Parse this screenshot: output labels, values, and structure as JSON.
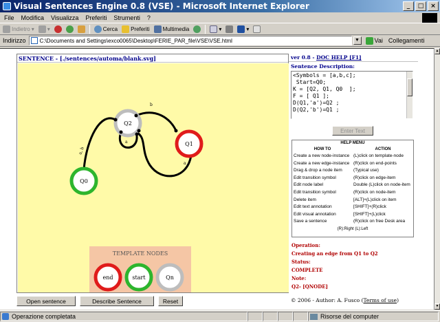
{
  "window": {
    "title": "Visual Sentences Engine 0.8 (VSE) - Microsoft Internet Explorer",
    "buttons": [
      "_",
      "□",
      "×"
    ]
  },
  "menu": [
    "File",
    "Modifica",
    "Visualizza",
    "Preferiti",
    "Strumenti",
    "?"
  ],
  "toolbar": {
    "back": "Indietro",
    "search": "Cerca",
    "favorites": "Preferiti",
    "multimedia": "Multimedia"
  },
  "address": {
    "label": "Indirizzo",
    "value": "C:\\Documents and Settings\\exco0065\\Desktop\\FERIE_PAR_file\\VSE\\VSE.html",
    "go": "Vai",
    "links": "Collegamenti"
  },
  "left": {
    "header": "SENTENCE - [./sentences/automa/blank.svg]",
    "template_title": "TEMPLATE NODES",
    "nodes": [
      {
        "name": "Q0",
        "color": "#2db52d"
      },
      {
        "name": "Q1",
        "color": "#e01b1b"
      },
      {
        "name": "Q2",
        "color": "#bdbdbd"
      }
    ],
    "edge_labels": [
      "a, b",
      "b",
      "a",
      "a"
    ],
    "templates": [
      {
        "name": "end",
        "color": "#e01b1b"
      },
      {
        "name": "start",
        "color": "#2db52d"
      },
      {
        "name": "Qn",
        "color": "#bdbdbd"
      }
    ],
    "buttons": {
      "open": "Open sentence",
      "describe": "Describe Sentence",
      "reset": "Reset"
    }
  },
  "right": {
    "header_prefix": "ver 0.8 - ",
    "header_link": "DOC HELP [F1]",
    "desc_label": "Sentence Description:",
    "desc_text": "<Symbols = [a,b,c];\n Start=Q0;\nK = [Q2, Q1, Q0  ];\nF = [ Q1 ];\nD(Q1,'a')=Q2 ;\nD(Q2,'b')=Q1 ;",
    "enter_text": "Enter Text",
    "help_title": "HELP MENU",
    "help_cols": [
      "HOW TO",
      "ACTION"
    ],
    "help_rows": [
      [
        "Create a new node-instance",
        "(L)click on template-node"
      ],
      [
        "Create a new edge-instance",
        "(R)click on end-points"
      ],
      [
        "Drag & drop a node item",
        "(Typical use)"
      ],
      [
        "Edit transition symbol",
        "(R)click on edge-item"
      ],
      [
        "Edit node label",
        "Double (L)click on node-item"
      ],
      [
        "Edit transition symbol",
        "(R)click on node-item"
      ],
      [
        "Delete item",
        "[ALT]+(L)click on item"
      ],
      [
        "Edit text annotation",
        "[SHIFT]+(R)click"
      ],
      [
        "Edit visual annotation",
        "[SHIFT]+(L)click"
      ],
      [
        "Save a sentence",
        "(R)click on free Desk area"
      ]
    ],
    "help_foot": "(R):Right     (L):Left",
    "status": {
      "operation_label": "Operation:",
      "operation_value": "Creating an edge from Q1 to Q2",
      "status_label": "Status:",
      "status_value": "COMPLETE",
      "note_label": "Note:",
      "note_value": "Q2- [QNODE]"
    },
    "footer_prefix": "© 2006 - Author: A. Fusco (",
    "footer_link": "Terms of use",
    "footer_suffix": ")"
  },
  "statusbar": {
    "left": "Operazione completata",
    "right": "Risorse del computer"
  }
}
